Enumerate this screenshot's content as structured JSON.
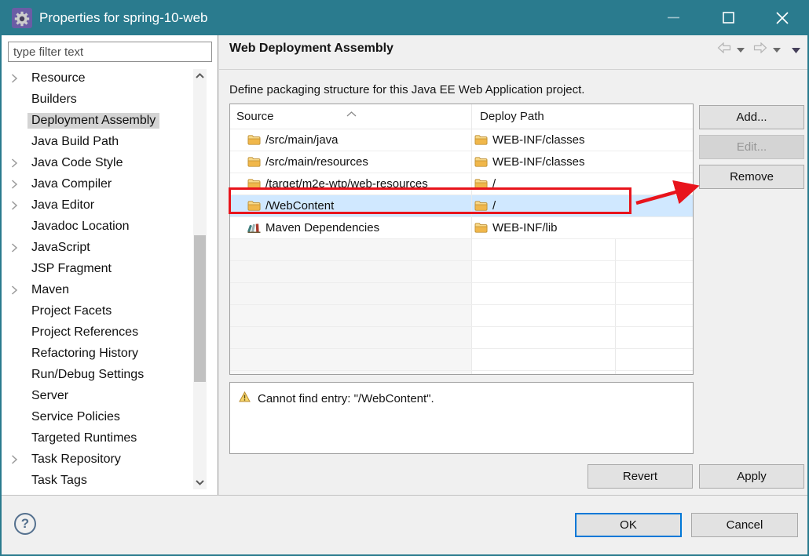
{
  "window": {
    "title": "Properties for spring-10-web"
  },
  "sidebar": {
    "filter_placeholder": "type filter text",
    "items": [
      {
        "label": "Resource",
        "expandable": true
      },
      {
        "label": "Builders"
      },
      {
        "label": "Deployment Assembly",
        "selected": true
      },
      {
        "label": "Java Build Path"
      },
      {
        "label": "Java Code Style",
        "expandable": true
      },
      {
        "label": "Java Compiler",
        "expandable": true
      },
      {
        "label": "Java Editor",
        "expandable": true
      },
      {
        "label": "Javadoc Location"
      },
      {
        "label": "JavaScript",
        "expandable": true
      },
      {
        "label": "JSP Fragment"
      },
      {
        "label": "Maven",
        "expandable": true
      },
      {
        "label": "Project Facets"
      },
      {
        "label": "Project References"
      },
      {
        "label": "Refactoring History"
      },
      {
        "label": "Run/Debug Settings"
      },
      {
        "label": "Server"
      },
      {
        "label": "Service Policies"
      },
      {
        "label": "Targeted Runtimes"
      },
      {
        "label": "Task Repository",
        "expandable": true
      },
      {
        "label": "Task Tags"
      }
    ]
  },
  "content": {
    "page_title": "Web Deployment Assembly",
    "description": "Define packaging structure for this Java EE Web Application project.",
    "table": {
      "columns": {
        "source": "Source",
        "deploy": "Deploy Path"
      },
      "rows": [
        {
          "source": "/src/main/java",
          "deploy": "WEB-INF/classes",
          "source_icon": "folder",
          "deploy_icon": "folder"
        },
        {
          "source": "/src/main/resources",
          "deploy": "WEB-INF/classes",
          "source_icon": "folder",
          "deploy_icon": "folder"
        },
        {
          "source": "/target/m2e-wtp/web-resources",
          "deploy": "/",
          "source_icon": "folder",
          "deploy_icon": "folder"
        },
        {
          "source": "/WebContent",
          "deploy": "/",
          "source_icon": "folder",
          "deploy_icon": "folder",
          "selected": true,
          "annotated": true
        },
        {
          "source": "Maven Dependencies",
          "deploy": "WEB-INF/lib",
          "source_icon": "library",
          "deploy_icon": "folder"
        }
      ],
      "empty_rows": 7
    },
    "side_buttons": {
      "add": "Add...",
      "edit": "Edit...",
      "remove": "Remove"
    },
    "warning": "Cannot find entry: \"/WebContent\".",
    "revert_label": "Revert",
    "apply_label": "Apply"
  },
  "footer": {
    "ok_label": "OK",
    "cancel_label": "Cancel"
  },
  "colors": {
    "titlebar": "#2a7b8e",
    "selection": "#d0e8ff",
    "annotation_red": "#e8141c",
    "focus_blue": "#0078d7",
    "folder_icon": "#f0b74b",
    "warning_amber": "#f6d56a"
  }
}
